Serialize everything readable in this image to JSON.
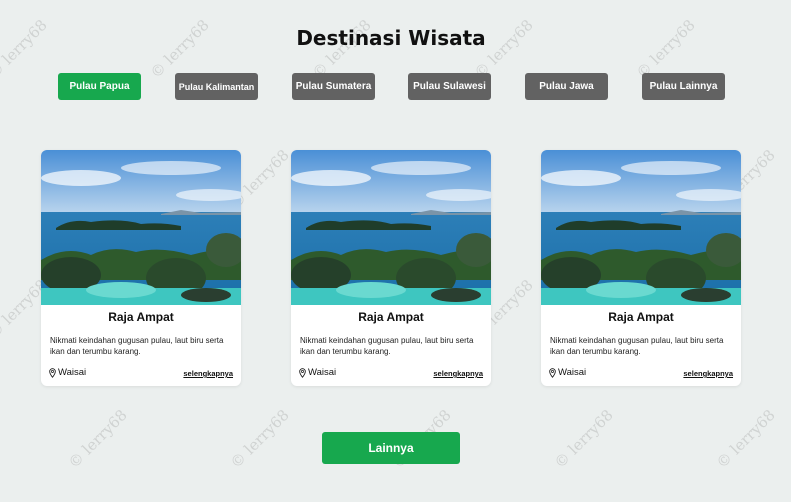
{
  "page": {
    "title": "Destinasi Wisata"
  },
  "tabs": [
    {
      "label": "Pulau Papua",
      "active": true
    },
    {
      "label": "Pulau Kalimantan",
      "active": false
    },
    {
      "label": "Pulau Sumatera",
      "active": false
    },
    {
      "label": "Pulau Sulawesi",
      "active": false
    },
    {
      "label": "Pulau Jawa",
      "active": false
    },
    {
      "label": "Pulau Lainnya",
      "active": false
    }
  ],
  "cards": [
    {
      "title": "Raja Ampat",
      "description": "Nikmati keindahan gugusan pulau, laut biru serta ikan dan terumbu karang.",
      "location": "Waisai",
      "link": "selengkapnya"
    },
    {
      "title": "Raja Ampat",
      "description": "Nikmati keindahan gugusan pulau, laut biru serta ikan dan terumbu karang.",
      "location": "Waisai",
      "link": "selengkapnya"
    },
    {
      "title": "Raja Ampat",
      "description": "Nikmati keindahan gugusan pulau, laut biru serta ikan dan terumbu karang.",
      "location": "Waisai",
      "link": "selengkapnya"
    }
  ],
  "more_button": {
    "label": "Lainnya"
  },
  "watermark": {
    "text": "© lerry68"
  },
  "colors": {
    "accent": "#17a84e",
    "tab_inactive": "#626262",
    "background": "#ebefee"
  },
  "icons": {
    "location": "map-pin-icon"
  }
}
